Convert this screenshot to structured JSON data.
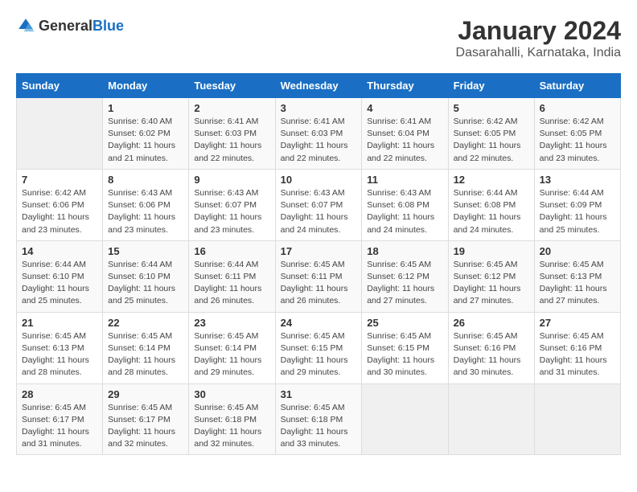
{
  "logo": {
    "general": "General",
    "blue": "Blue"
  },
  "title": "January 2024",
  "subtitle": "Dasarahalli, Karnataka, India",
  "days_of_week": [
    "Sunday",
    "Monday",
    "Tuesday",
    "Wednesday",
    "Thursday",
    "Friday",
    "Saturday"
  ],
  "weeks": [
    [
      {
        "day": "",
        "sunrise": "",
        "sunset": "",
        "daylight": ""
      },
      {
        "day": "1",
        "sunrise": "Sunrise: 6:40 AM",
        "sunset": "Sunset: 6:02 PM",
        "daylight": "Daylight: 11 hours and 21 minutes."
      },
      {
        "day": "2",
        "sunrise": "Sunrise: 6:41 AM",
        "sunset": "Sunset: 6:03 PM",
        "daylight": "Daylight: 11 hours and 22 minutes."
      },
      {
        "day": "3",
        "sunrise": "Sunrise: 6:41 AM",
        "sunset": "Sunset: 6:03 PM",
        "daylight": "Daylight: 11 hours and 22 minutes."
      },
      {
        "day": "4",
        "sunrise": "Sunrise: 6:41 AM",
        "sunset": "Sunset: 6:04 PM",
        "daylight": "Daylight: 11 hours and 22 minutes."
      },
      {
        "day": "5",
        "sunrise": "Sunrise: 6:42 AM",
        "sunset": "Sunset: 6:05 PM",
        "daylight": "Daylight: 11 hours and 22 minutes."
      },
      {
        "day": "6",
        "sunrise": "Sunrise: 6:42 AM",
        "sunset": "Sunset: 6:05 PM",
        "daylight": "Daylight: 11 hours and 23 minutes."
      }
    ],
    [
      {
        "day": "7",
        "sunrise": "Sunrise: 6:42 AM",
        "sunset": "Sunset: 6:06 PM",
        "daylight": "Daylight: 11 hours and 23 minutes."
      },
      {
        "day": "8",
        "sunrise": "Sunrise: 6:43 AM",
        "sunset": "Sunset: 6:06 PM",
        "daylight": "Daylight: 11 hours and 23 minutes."
      },
      {
        "day": "9",
        "sunrise": "Sunrise: 6:43 AM",
        "sunset": "Sunset: 6:07 PM",
        "daylight": "Daylight: 11 hours and 23 minutes."
      },
      {
        "day": "10",
        "sunrise": "Sunrise: 6:43 AM",
        "sunset": "Sunset: 6:07 PM",
        "daylight": "Daylight: 11 hours and 24 minutes."
      },
      {
        "day": "11",
        "sunrise": "Sunrise: 6:43 AM",
        "sunset": "Sunset: 6:08 PM",
        "daylight": "Daylight: 11 hours and 24 minutes."
      },
      {
        "day": "12",
        "sunrise": "Sunrise: 6:44 AM",
        "sunset": "Sunset: 6:08 PM",
        "daylight": "Daylight: 11 hours and 24 minutes."
      },
      {
        "day": "13",
        "sunrise": "Sunrise: 6:44 AM",
        "sunset": "Sunset: 6:09 PM",
        "daylight": "Daylight: 11 hours and 25 minutes."
      }
    ],
    [
      {
        "day": "14",
        "sunrise": "Sunrise: 6:44 AM",
        "sunset": "Sunset: 6:10 PM",
        "daylight": "Daylight: 11 hours and 25 minutes."
      },
      {
        "day": "15",
        "sunrise": "Sunrise: 6:44 AM",
        "sunset": "Sunset: 6:10 PM",
        "daylight": "Daylight: 11 hours and 25 minutes."
      },
      {
        "day": "16",
        "sunrise": "Sunrise: 6:44 AM",
        "sunset": "Sunset: 6:11 PM",
        "daylight": "Daylight: 11 hours and 26 minutes."
      },
      {
        "day": "17",
        "sunrise": "Sunrise: 6:45 AM",
        "sunset": "Sunset: 6:11 PM",
        "daylight": "Daylight: 11 hours and 26 minutes."
      },
      {
        "day": "18",
        "sunrise": "Sunrise: 6:45 AM",
        "sunset": "Sunset: 6:12 PM",
        "daylight": "Daylight: 11 hours and 27 minutes."
      },
      {
        "day": "19",
        "sunrise": "Sunrise: 6:45 AM",
        "sunset": "Sunset: 6:12 PM",
        "daylight": "Daylight: 11 hours and 27 minutes."
      },
      {
        "day": "20",
        "sunrise": "Sunrise: 6:45 AM",
        "sunset": "Sunset: 6:13 PM",
        "daylight": "Daylight: 11 hours and 27 minutes."
      }
    ],
    [
      {
        "day": "21",
        "sunrise": "Sunrise: 6:45 AM",
        "sunset": "Sunset: 6:13 PM",
        "daylight": "Daylight: 11 hours and 28 minutes."
      },
      {
        "day": "22",
        "sunrise": "Sunrise: 6:45 AM",
        "sunset": "Sunset: 6:14 PM",
        "daylight": "Daylight: 11 hours and 28 minutes."
      },
      {
        "day": "23",
        "sunrise": "Sunrise: 6:45 AM",
        "sunset": "Sunset: 6:14 PM",
        "daylight": "Daylight: 11 hours and 29 minutes."
      },
      {
        "day": "24",
        "sunrise": "Sunrise: 6:45 AM",
        "sunset": "Sunset: 6:15 PM",
        "daylight": "Daylight: 11 hours and 29 minutes."
      },
      {
        "day": "25",
        "sunrise": "Sunrise: 6:45 AM",
        "sunset": "Sunset: 6:15 PM",
        "daylight": "Daylight: 11 hours and 30 minutes."
      },
      {
        "day": "26",
        "sunrise": "Sunrise: 6:45 AM",
        "sunset": "Sunset: 6:16 PM",
        "daylight": "Daylight: 11 hours and 30 minutes."
      },
      {
        "day": "27",
        "sunrise": "Sunrise: 6:45 AM",
        "sunset": "Sunset: 6:16 PM",
        "daylight": "Daylight: 11 hours and 31 minutes."
      }
    ],
    [
      {
        "day": "28",
        "sunrise": "Sunrise: 6:45 AM",
        "sunset": "Sunset: 6:17 PM",
        "daylight": "Daylight: 11 hours and 31 minutes."
      },
      {
        "day": "29",
        "sunrise": "Sunrise: 6:45 AM",
        "sunset": "Sunset: 6:17 PM",
        "daylight": "Daylight: 11 hours and 32 minutes."
      },
      {
        "day": "30",
        "sunrise": "Sunrise: 6:45 AM",
        "sunset": "Sunset: 6:18 PM",
        "daylight": "Daylight: 11 hours and 32 minutes."
      },
      {
        "day": "31",
        "sunrise": "Sunrise: 6:45 AM",
        "sunset": "Sunset: 6:18 PM",
        "daylight": "Daylight: 11 hours and 33 minutes."
      },
      {
        "day": "",
        "sunrise": "",
        "sunset": "",
        "daylight": ""
      },
      {
        "day": "",
        "sunrise": "",
        "sunset": "",
        "daylight": ""
      },
      {
        "day": "",
        "sunrise": "",
        "sunset": "",
        "daylight": ""
      }
    ]
  ]
}
